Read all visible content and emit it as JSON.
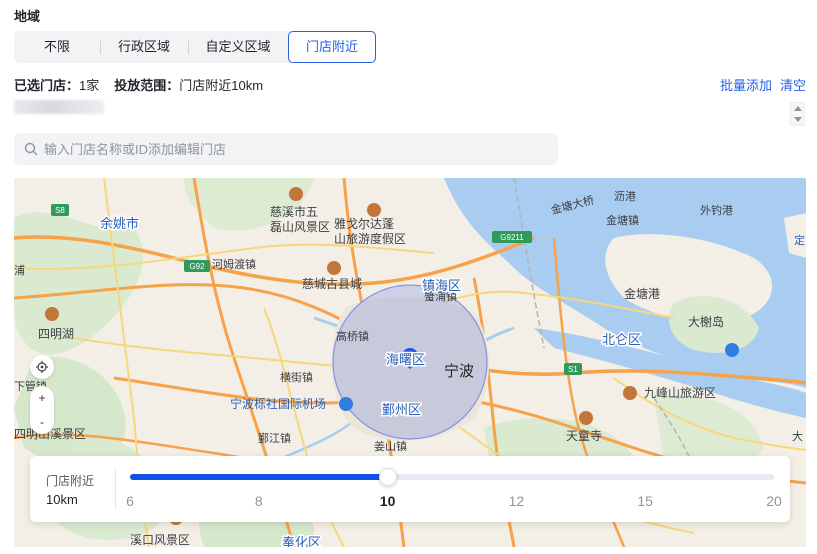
{
  "section": {
    "title": "地域"
  },
  "tabs": [
    {
      "label": "不限",
      "active": false
    },
    {
      "label": "行政区域",
      "active": false
    },
    {
      "label": "自定义区域",
      "active": false
    },
    {
      "label": "门店附近",
      "active": true
    }
  ],
  "summary": {
    "selected_label": "已选门店：",
    "selected_value": "1家",
    "range_label": "投放范围：",
    "range_value": "门店附近10km"
  },
  "actions": {
    "bulk_add": "批量添加",
    "clear": "清空"
  },
  "search": {
    "placeholder": "输入门店名称或ID添加编辑门店"
  },
  "map": {
    "labels": {
      "cixi": "慈溪市五\n磊山风景区",
      "yage": "雅戈尔达蓬\n山旅游度假区",
      "cixiold": "慈城古县城",
      "hemudu": "河姆渡镇",
      "yuyao": "余姚市",
      "siming": "四明湖",
      "zhenhai": "镇海区",
      "gaoqiao": "高桥镇",
      "haishu": "海曙区",
      "ningbo": "宁波",
      "airport": "宁波栎社国际机场",
      "yinzhou": "鄞州区",
      "hengjie": "横街镇",
      "yinjiang": "鄞江镇",
      "jiangshan": "姜山镇",
      "beilun": "北仑区",
      "jintang": "金塘港",
      "jintangzhen": "金塘镇",
      "daxie": "大榭岛",
      "jiufeng": "九峰山旅游区",
      "tiantong": "天童寺",
      "xikou": "溪口风景区",
      "fenghua": "奉化区",
      "xiaogang": "沥港",
      "waidiao": "外钓港",
      "jintangbridge": "金塘大桥",
      "xiepan": "蟹浦镇",
      "xiadongqiao": "下管镇",
      "simingxi": "四明山溪景区",
      "xiaozhuang": "浦",
      "dashe": "大",
      "huoban": "定",
      "yuyaoroad": "G92",
      "g9211": "G9211",
      "s1": "S1",
      "s8": "S8"
    }
  },
  "radius": {
    "label": "门店附近",
    "value_text": "10km",
    "min": 6,
    "max": 20,
    "value": 10,
    "ticks": [
      "6",
      "8",
      "10",
      "12",
      "15",
      "20"
    ]
  },
  "colors": {
    "primary": "#2761e8",
    "slider_fill": "#1050e6",
    "circle_fill": "#6b82e6",
    "road_orange": "#f7a24a",
    "sea": "#a9cdf0"
  }
}
